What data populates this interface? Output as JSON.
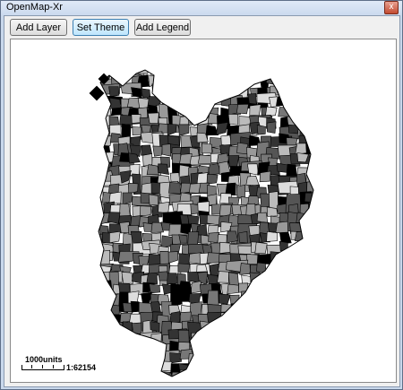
{
  "window": {
    "title": "OpenMap-Xr",
    "close_glyph": "x"
  },
  "toolbar": {
    "add_layer_label": "Add Layer",
    "set_theme_label": "Set Theme",
    "add_legend_label": "Add Legend"
  },
  "map": {
    "fill_shades": [
      "#000000",
      "#333333",
      "#555555",
      "#777777",
      "#999999",
      "#bbbbbb",
      "#dddddd"
    ],
    "boundary_color": "#000000",
    "background": "#ffffff"
  },
  "scale": {
    "distance_label": "1000units",
    "ratio_label": "1:62154"
  }
}
